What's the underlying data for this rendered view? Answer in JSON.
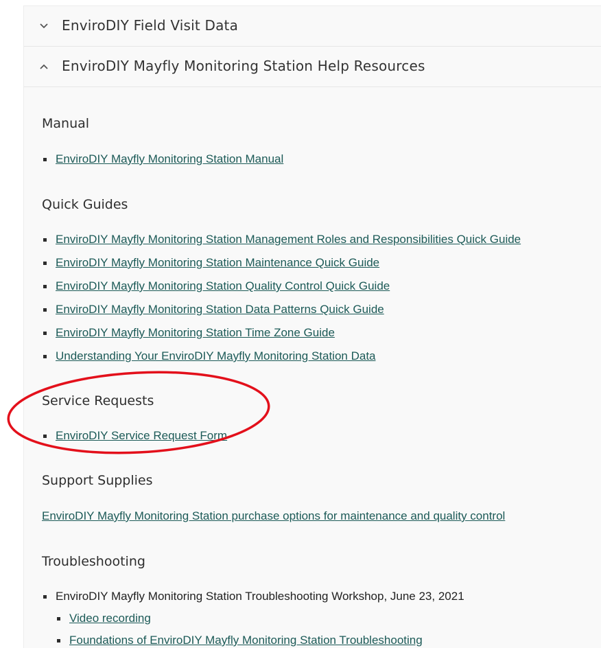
{
  "accordion": {
    "collapsed_header": "EnviroDIY Field Visit Data",
    "expanded_header": "EnviroDIY Mayfly Monitoring Station Help Resources"
  },
  "sections": {
    "manual": {
      "title": "Manual",
      "links": [
        "EnviroDIY Mayfly Monitoring Station Manual"
      ]
    },
    "quick_guides": {
      "title": "Quick Guides",
      "links": [
        "EnviroDIY Mayfly Monitoring Station Management Roles and Responsibilities Quick Guide",
        "EnviroDIY Mayfly Monitoring Station Maintenance Quick Guide",
        "EnviroDIY Mayfly Monitoring Station Quality Control Quick Guide",
        "EnviroDIY Mayfly Monitoring Station Data Patterns Quick Guide",
        "EnviroDIY Mayfly Monitoring Station Time Zone Guide",
        "Understanding Your EnviroDIY Mayfly Monitoring Station Data"
      ]
    },
    "service_requests": {
      "title": "Service Requests",
      "links": [
        "EnviroDIY Service Request Form"
      ]
    },
    "support_supplies": {
      "title": "Support Supplies",
      "link": "EnviroDIY Mayfly Monitoring Station purchase options for maintenance and quality control"
    },
    "troubleshooting": {
      "title": "Troubleshooting",
      "item": "EnviroDIY Mayfly Monitoring Station Troubleshooting Workshop, June 23, 2021",
      "sub_links": [
        "Video recording",
        "Foundations of EnviroDIY Mayfly Monitoring Station Troubleshooting"
      ]
    }
  },
  "annotation": {
    "color": "#e3101b"
  },
  "icons": {
    "collapsed": "chevron-down-icon",
    "expanded": "chevron-up-icon"
  }
}
